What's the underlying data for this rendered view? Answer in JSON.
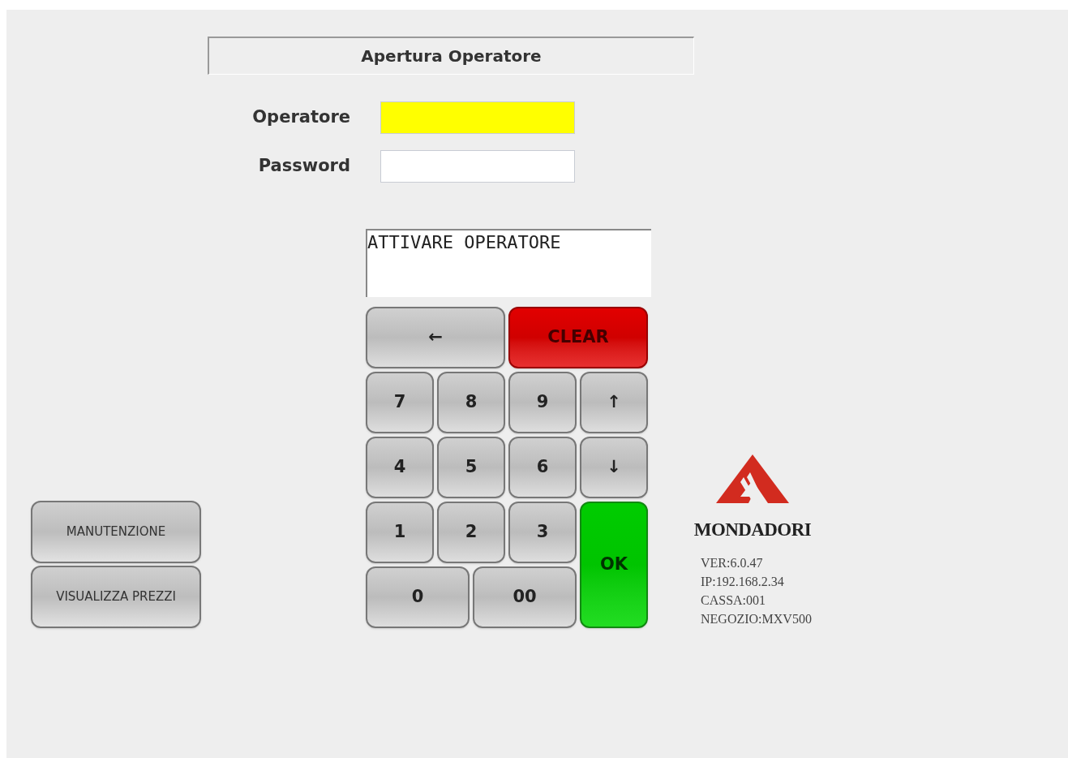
{
  "title": "Apertura Operatore",
  "fields": [
    {
      "label": "Operatore",
      "focused": true
    },
    {
      "label": "Password",
      "focused": false
    }
  ],
  "message": "ATTIVARE OPERATORE",
  "side_buttons": [
    "MANUTENZIONE",
    "VISUALIZZA PREZZI"
  ],
  "keypad": [
    {
      "label": "←",
      "kind": "normal"
    },
    {
      "label": "CLEAR",
      "kind": "danger"
    },
    {
      "label": "7",
      "kind": "normal"
    },
    {
      "label": "8",
      "kind": "normal"
    },
    {
      "label": "9",
      "kind": "normal"
    },
    {
      "label": "↑",
      "kind": "normal"
    },
    {
      "label": "4",
      "kind": "normal"
    },
    {
      "label": "5",
      "kind": "normal"
    },
    {
      "label": "6",
      "kind": "normal"
    },
    {
      "label": "↓",
      "kind": "normal"
    },
    {
      "label": "1",
      "kind": "normal"
    },
    {
      "label": "2",
      "kind": "normal"
    },
    {
      "label": "3",
      "kind": "normal"
    },
    {
      "label": "OK",
      "kind": "confirm"
    },
    {
      "label": "0",
      "kind": "normal"
    },
    {
      "label": "00",
      "kind": "normal"
    }
  ],
  "brand": "MONDADORI",
  "info": [
    "VER:6.0.47",
    "IP:192.168.2.34",
    "CASSA:001",
    "NEGOZIO:MXV500"
  ]
}
